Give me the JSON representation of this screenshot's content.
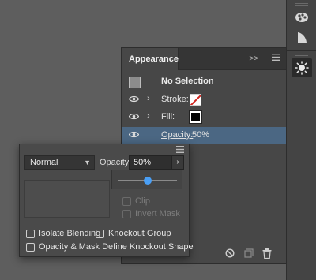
{
  "appearance_panel": {
    "tab_label": "Appearance",
    "collapse_glyph": ">>",
    "header_row": {
      "label": "No Selection"
    },
    "rows": [
      {
        "label": "Stroke:"
      },
      {
        "label": "Fill:"
      },
      {
        "label": "Opacity:",
        "value": "50%"
      }
    ]
  },
  "transparency_panel": {
    "blend_mode": "Normal",
    "opacity_label": "Opacity:",
    "opacity_value": "50%",
    "opacity_fraction": 0.5,
    "clip_label": "Clip",
    "invert_mask_label": "Invert Mask",
    "isolate_blending_label": "Isolate Blending",
    "knockout_group_label": "Knockout Group",
    "opacity_mask_define_label": "Opacity & Mask Define Knockout Shape"
  },
  "colors": {
    "selection_row": "#4b6783",
    "slider_thumb": "#4a9ff5",
    "stroke_swatch_slash": "#d0241f"
  },
  "icons": {
    "dock": [
      "brushes-icon",
      "symbols-icon",
      "appearance-sun-icon"
    ],
    "panel_footer": [
      "clear-appearance-icon",
      "duplicate-item-icon",
      "delete-item-icon"
    ]
  }
}
